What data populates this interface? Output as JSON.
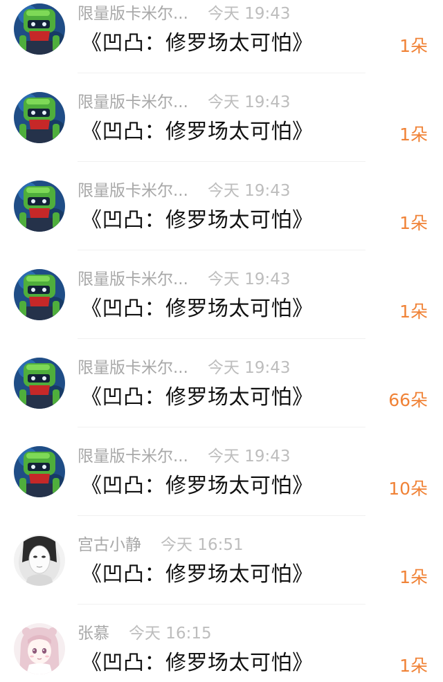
{
  "gift_list": {
    "items": [
      {
        "name": "限量版卡米尔...",
        "time": "今天 19:43",
        "gift": "《凹凸：修罗场太可怕》",
        "count": "1朵",
        "avatar_icon": "robot-green-avatar-icon"
      },
      {
        "name": "限量版卡米尔...",
        "time": "今天 19:43",
        "gift": "《凹凸：修罗场太可怕》",
        "count": "1朵",
        "avatar_icon": "robot-green-avatar-icon"
      },
      {
        "name": "限量版卡米尔...",
        "time": "今天 19:43",
        "gift": "《凹凸：修罗场太可怕》",
        "count": "1朵",
        "avatar_icon": "robot-green-avatar-icon"
      },
      {
        "name": "限量版卡米尔...",
        "time": "今天 19:43",
        "gift": "《凹凸：修罗场太可怕》",
        "count": "1朵",
        "avatar_icon": "robot-green-avatar-icon"
      },
      {
        "name": "限量版卡米尔...",
        "time": "今天 19:43",
        "gift": "《凹凸：修罗场太可怕》",
        "count": "66朵",
        "avatar_icon": "robot-green-avatar-icon"
      },
      {
        "name": "限量版卡米尔...",
        "time": "今天 19:43",
        "gift": "《凹凸：修罗场太可怕》",
        "count": "10朵",
        "avatar_icon": "robot-green-avatar-icon"
      },
      {
        "name": "宫古小静",
        "time": "今天 16:51",
        "gift": "《凹凸：修罗场太可怕》",
        "count": "1朵",
        "avatar_icon": "white-mask-avatar-icon"
      },
      {
        "name": "张慕",
        "time": "今天 16:15",
        "gift": "《凹凸：修罗场太可怕》",
        "count": "1朵",
        "avatar_icon": "anime-girl-avatar-icon"
      }
    ]
  },
  "colors": {
    "count_accent": "#f08236",
    "meta_text": "#a8a8a8",
    "gift_text": "#111111"
  }
}
